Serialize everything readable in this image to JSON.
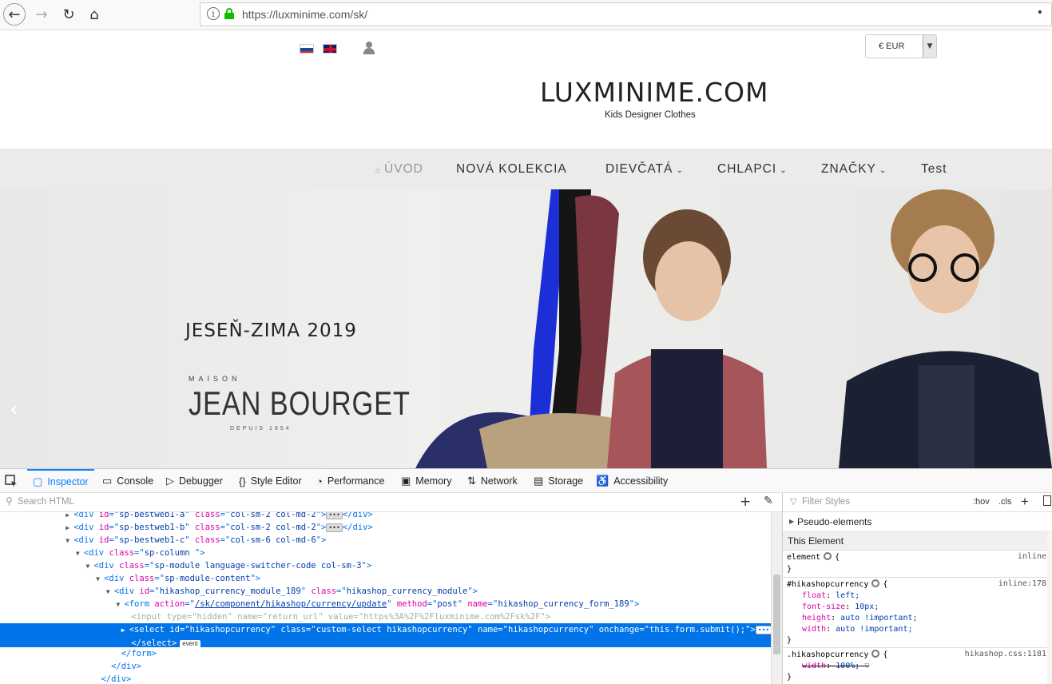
{
  "browser": {
    "url": "https://luxminime.com/sk/",
    "info_glyph": "i",
    "menu_glyph": "•",
    "back_glyph": "←",
    "forward_glyph": "→",
    "reload_glyph": "↻",
    "home_glyph": "⌂"
  },
  "site": {
    "currency": "€ EUR",
    "logo": "LUXMINIME.COM",
    "tagline": "Kids Designer Clothes",
    "menu": [
      {
        "label": "ÚVOD",
        "icon": "home-icon",
        "active": true
      },
      {
        "label": "NOVÁ KOLEKCIA"
      },
      {
        "label": "DIEVČATÁ",
        "dropdown": true
      },
      {
        "label": "CHLAPCI",
        "dropdown": true
      },
      {
        "label": "ZNAČKY",
        "dropdown": true
      },
      {
        "label": "Test"
      }
    ],
    "hero": {
      "title": "JESEŇ-ZIMA 2019",
      "brand_top": "MAISON",
      "brand_main": "JEAN BOURGET",
      "brand_sub": "DEPUIS 1954",
      "prev_arrow": "‹"
    }
  },
  "devtools": {
    "tabs": [
      {
        "label": "Inspector",
        "icon": "inspector-icon",
        "active": true
      },
      {
        "label": "Console",
        "icon": "console-icon"
      },
      {
        "label": "Debugger",
        "icon": "debugger-icon"
      },
      {
        "label": "Style Editor",
        "icon": "style-editor-icon"
      },
      {
        "label": "Performance",
        "icon": "performance-icon"
      },
      {
        "label": "Memory",
        "icon": "memory-icon"
      },
      {
        "label": "Network",
        "icon": "network-icon"
      },
      {
        "label": "Storage",
        "icon": "storage-icon"
      },
      {
        "label": "Accessibility",
        "icon": "accessibility-icon"
      }
    ],
    "search_placeholder": "Search HTML",
    "tree": {
      "l1": {
        "id": "sp-bestweb1-a",
        "cls": "col-sm-2 col-md-2"
      },
      "l2": {
        "id": "sp-bestweb1-b",
        "cls": "col-sm-2 col-md-2"
      },
      "l3": {
        "id": "sp-bestweb1-c",
        "cls": "col-sm-6 col-md-6"
      },
      "l4": {
        "cls": "sp-column "
      },
      "l5": {
        "cls": "sp-module language-switcher-code col-sm-3"
      },
      "l6": {
        "cls": "sp-module-content"
      },
      "l7": {
        "id": "hikashop_currency_module_189",
        "cls": "hikashop_currency_module"
      },
      "l8": {
        "action": "/sk/component/hikashop/currency/update",
        "method": "post",
        "name": "hikashop_currency_form_189"
      },
      "l9": {
        "type": "hidden",
        "name": "return_url",
        "value": "https%3A%2F%2Fluxminime.com%2Fsk%2F"
      },
      "l10": {
        "id": "hikashopcurrency",
        "cls": "custom-select hikashopcurrency",
        "name": "hikashopcurrency",
        "onchange": "this.form.submit();"
      },
      "event_badge": "event",
      "ellipsis": "•••"
    },
    "rules": {
      "filter_placeholder": "Filter Styles",
      "hov": ":hov",
      "cls": ".cls",
      "pseudo": "Pseudo-elements",
      "this_element": "This Element",
      "element_selector": "element",
      "element_src": "inline",
      "r1_selector": "#hikashopcurrency",
      "r1_src": "inline:178",
      "r1_props": [
        {
          "p": "float",
          "v": "left;"
        },
        {
          "p": "font-size",
          "v": "10px;"
        },
        {
          "p": "height",
          "v": "auto !important;"
        },
        {
          "p": "width",
          "v": "auto !important;"
        }
      ],
      "r2_selector": ".hikashopcurrency",
      "r2_src": "hikashop.css:1181",
      "r2_prop": "width",
      "r2_val": "100%;"
    }
  }
}
